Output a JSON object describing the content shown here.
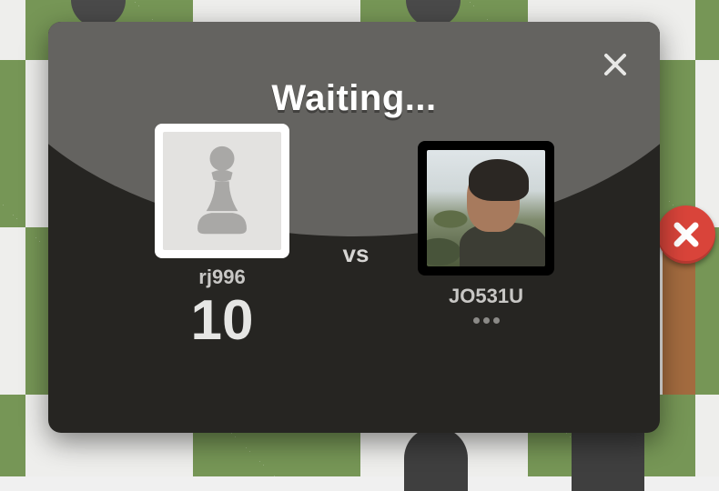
{
  "modal": {
    "title": "Waiting...",
    "close_icon": "close-icon",
    "vs_label": "vs"
  },
  "player_left": {
    "name": "rj996",
    "rating": "10",
    "avatar_icon": "pawn-icon"
  },
  "player_right": {
    "name": "JO531U",
    "status_icon": "ellipsis-icon"
  },
  "outer_close_icon": "close-icon",
  "colors": {
    "board_light": "#eeeeec",
    "board_dark": "#769656",
    "modal_bg": "#262522",
    "modal_header": "#646360",
    "close_red": "#d9443a"
  }
}
